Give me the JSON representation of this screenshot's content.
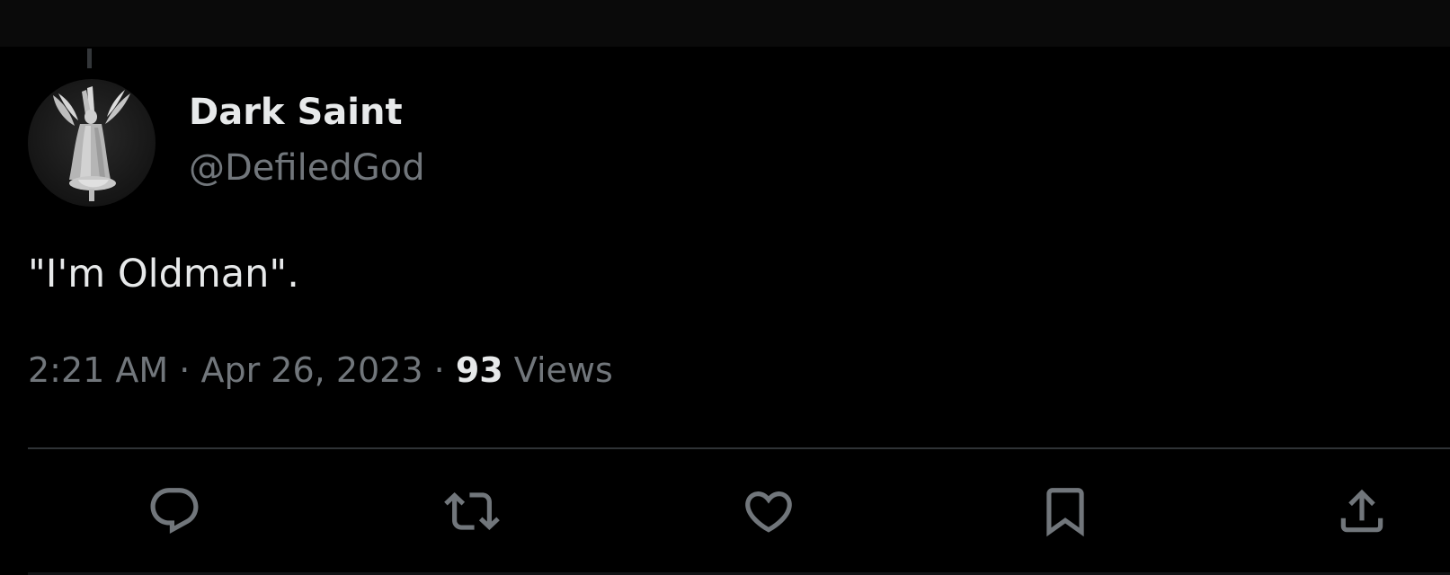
{
  "tweet": {
    "author": {
      "display_name": "Dark Saint",
      "handle": "@DefiledGod"
    },
    "text": "\"I'm Oldman\".",
    "meta": {
      "time": "2:21 AM",
      "separator": "·",
      "date": "Apr 26, 2023",
      "views_count": "93",
      "views_label": "Views"
    },
    "actions": [
      {
        "name": "reply",
        "icon": "reply-icon"
      },
      {
        "name": "retweet",
        "icon": "retweet-icon"
      },
      {
        "name": "like",
        "icon": "heart-icon"
      },
      {
        "name": "bookmark",
        "icon": "bookmark-icon"
      },
      {
        "name": "share",
        "icon": "share-icon"
      }
    ]
  },
  "colors": {
    "background": "#000000",
    "primary_text": "#e7e9ea",
    "secondary_text": "#71767b",
    "divider": "#2f3336"
  }
}
